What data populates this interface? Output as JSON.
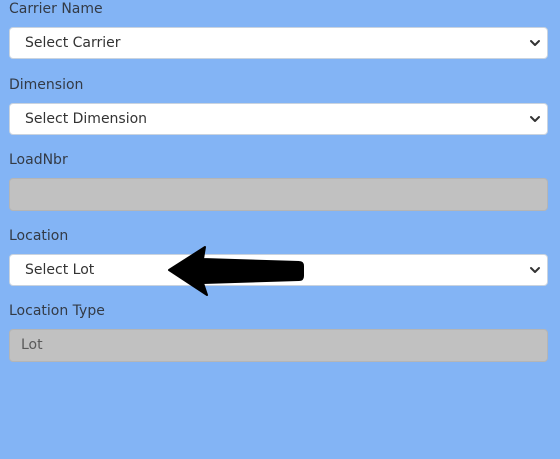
{
  "form": {
    "carrier": {
      "label": "Carrier Name",
      "selected": "Select Carrier"
    },
    "dimension": {
      "label": "Dimension",
      "selected": "Select Dimension"
    },
    "load_nbr": {
      "label": "LoadNbr",
      "value": ""
    },
    "location": {
      "label": "Location",
      "selected": "Select Lot"
    },
    "location_type": {
      "label": "Location Type",
      "value": "Lot"
    }
  },
  "icons": {
    "select_chevron": "chevron-down-icon",
    "annotation": "arrow-left-icon"
  },
  "colors": {
    "background": "#83b4f5",
    "readonly_field": "#c1c1c1",
    "arrow": "#000000"
  }
}
